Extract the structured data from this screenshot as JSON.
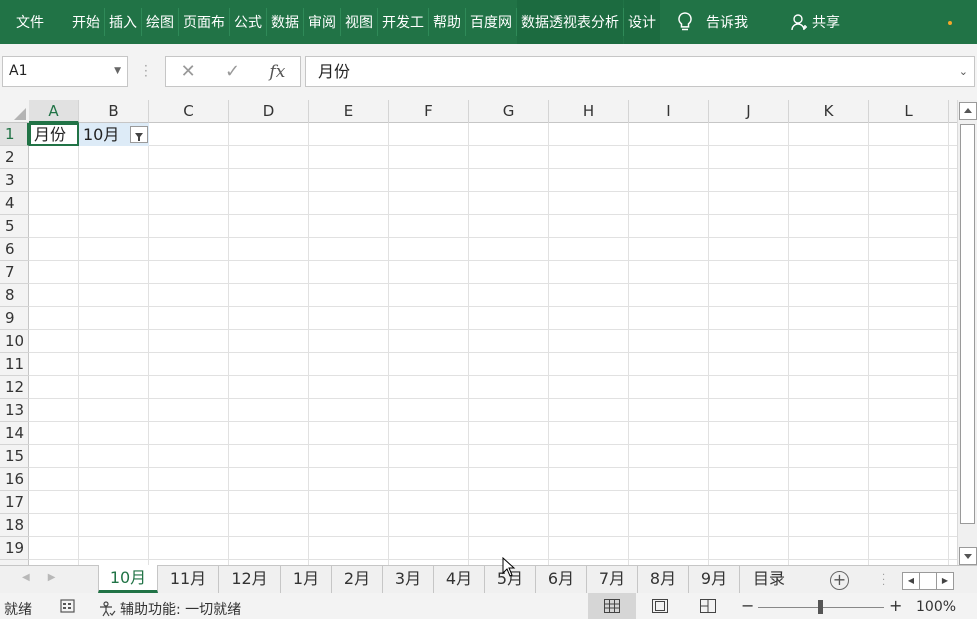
{
  "ribbon": {
    "tabs": [
      "文件",
      "开始",
      "插入",
      "绘图",
      "页面布",
      "公式",
      "数据",
      "审阅",
      "视图",
      "开发工",
      "帮助",
      "百度网",
      "数据透视表分析",
      "设计"
    ],
    "tell_me": "告诉我",
    "share": "共享",
    "bulb_icon": "lightbulb-icon",
    "share_icon": "person-icon"
  },
  "formula_bar": {
    "name_box": "A1",
    "content": "月份"
  },
  "columns": [
    "A",
    "B",
    "C",
    "D",
    "E",
    "F",
    "G",
    "H",
    "I",
    "J",
    "K",
    "L"
  ],
  "rows": [
    "1",
    "2",
    "3",
    "4",
    "5",
    "6",
    "7",
    "8",
    "9",
    "10",
    "11",
    "12",
    "13",
    "14",
    "15",
    "16",
    "17",
    "18",
    "19"
  ],
  "cells": {
    "A1": "月份",
    "B1": "10月"
  },
  "sheet_tabs": [
    "10月",
    "11月",
    "12月",
    "1月",
    "2月",
    "3月",
    "4月",
    "5月",
    "6月",
    "7月",
    "8月",
    "9月",
    "目录"
  ],
  "active_sheet": "10月",
  "status": {
    "ready": "就绪",
    "accessibility": "辅助功能: 一切就绪",
    "zoom": "100%"
  },
  "colors": {
    "accent": "#217346",
    "filter_fill": "#ddebf7"
  }
}
